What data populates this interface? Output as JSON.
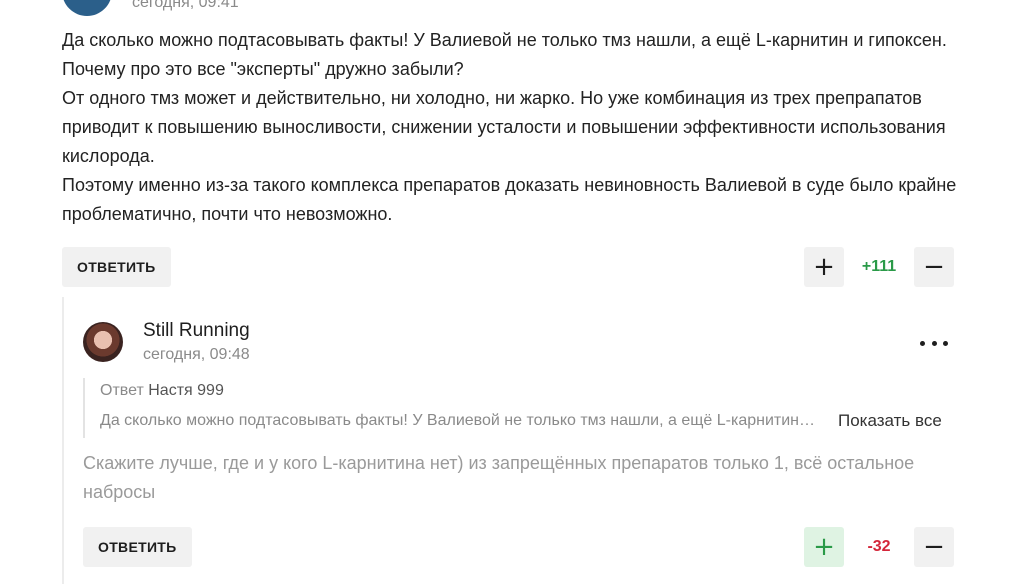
{
  "top_comment": {
    "time": "сегодня, 09:41",
    "paragraphs": [
      "Да сколько можно подтасовывать факты! У Валиевой не только тмз нашли, а ещё L-карнитин и гипоксен. Почему про это все \"эксперты\" дружно забыли?",
      "От одного тмз может и действительно, ни холодно, ни жарко. Но уже комбинация из трех препрапатов приводит к повышению выносливости, снижении усталости и повышении эффективности использования кислорода.",
      "Поэтому именно из-за такого комплекса препаратов доказать невиновность Валиевой в суде было крайне проблематично, почти что невозможно."
    ],
    "reply_label": "ОТВЕТИТЬ",
    "score": "+111",
    "plus": "+",
    "minus": "−"
  },
  "reply_comment": {
    "author": "Still Running",
    "time": "сегодня, 09:48",
    "quote_prefix": "Ответ",
    "quote_name": "Настя 999",
    "quote_snippet": "Да сколько можно подтасовывать факты! У Валиевой не только тмз нашли, а ещё L-карнитин и гипоксен.",
    "show_all": "Показать все",
    "text": "Скажите лучше, где и у кого L-карнитина нет) из запрещённых препаратов только 1, всё остальное набросы",
    "reply_label": "ОТВЕТИТЬ",
    "score": "-32",
    "plus": "+",
    "minus": "−"
  },
  "colors": {
    "positive": "#2a9a48",
    "negative": "#d4263a",
    "button_bg": "#f1f1f1"
  }
}
